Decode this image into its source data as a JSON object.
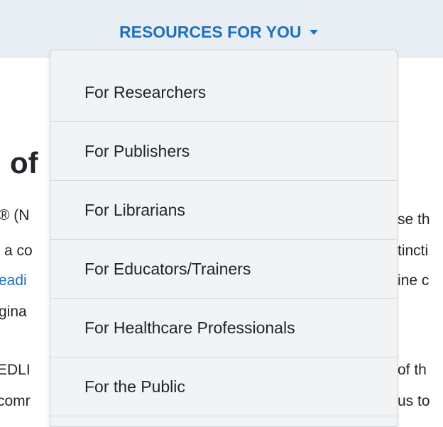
{
  "nav": {
    "dropdown_label": "RESOURCES FOR YOU",
    "caret_icon": "caret-down-icon",
    "accent_color": "#1f6fc0"
  },
  "page": {
    "heading_fragment": "of",
    "text_fragments": {
      "l1": "® (N",
      "l2": "a co",
      "l3": "eadi",
      "l4": "gina",
      "l5": "EDLI",
      "l6": "comr",
      "r1": "se th",
      "r2": "tincti",
      "r3": "ine c",
      "r5": "of th",
      "r6": "us to"
    }
  },
  "dropdown": {
    "items": [
      {
        "label": "For Researchers"
      },
      {
        "label": "For Publishers"
      },
      {
        "label": "For Librarians"
      },
      {
        "label": "For Educators/Trainers"
      },
      {
        "label": "For Healthcare Professionals"
      },
      {
        "label": "For the Public"
      }
    ]
  }
}
